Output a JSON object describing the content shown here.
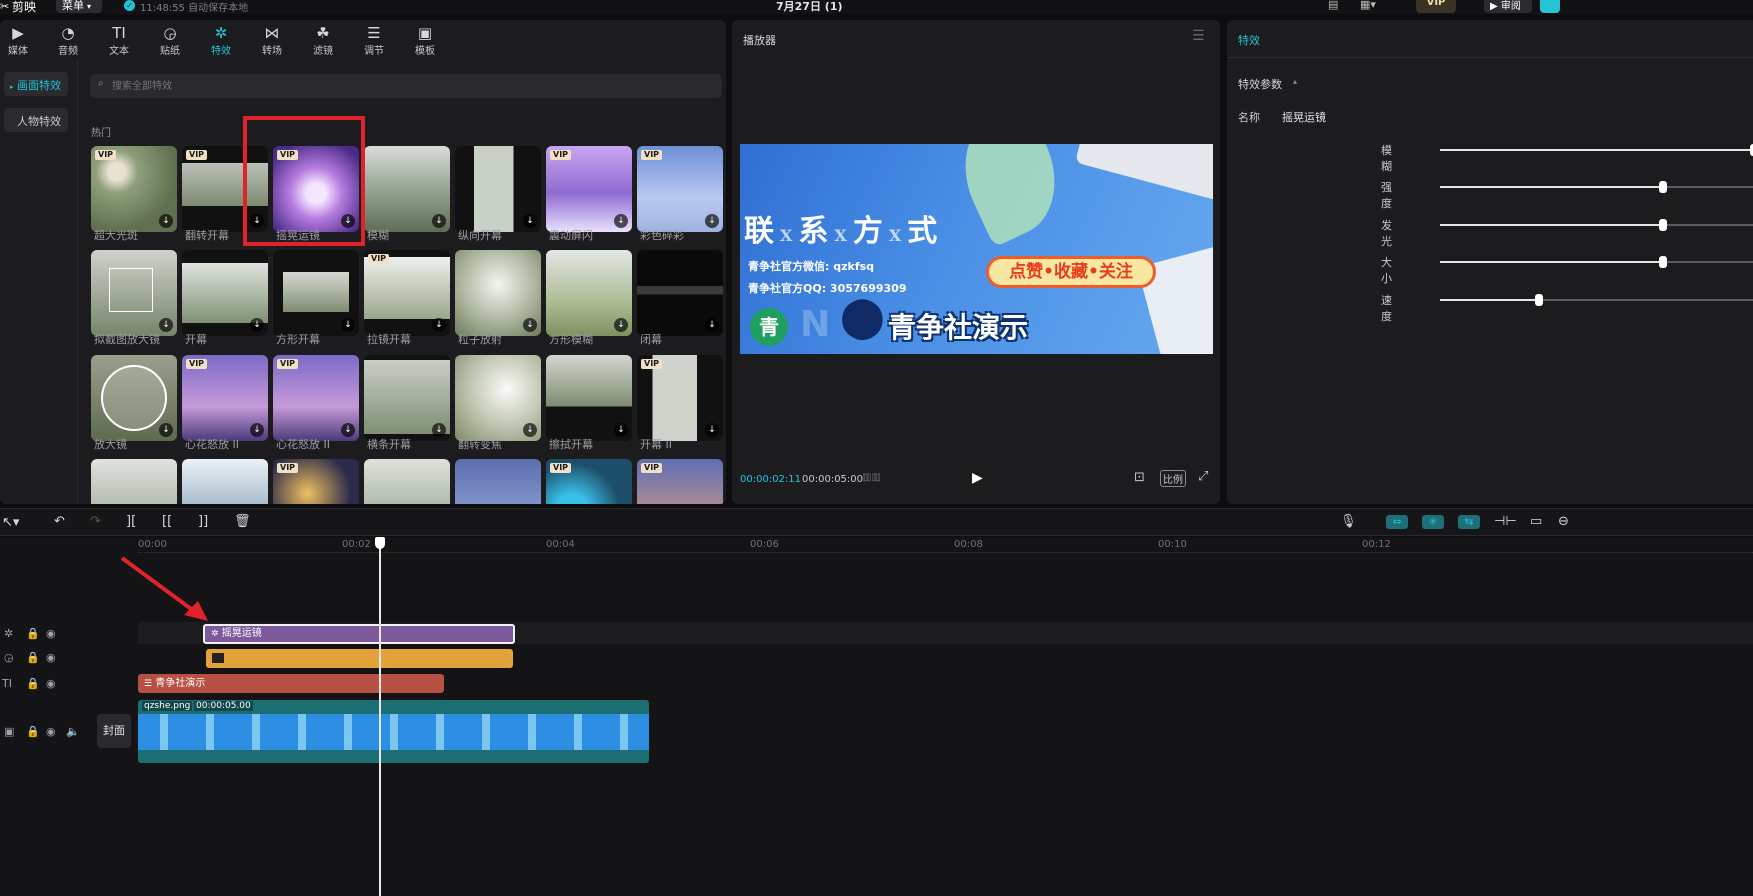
{
  "app": {
    "name": "剪映",
    "menu_label": "菜单",
    "autosave_text": "11:48:55 自动保存本地",
    "project_title": "7月27日 (1)",
    "vip_label": "VIP",
    "review_label": "审阅"
  },
  "toolbar": {
    "tabs": [
      {
        "label": "媒体",
        "icon": "media-icon"
      },
      {
        "label": "音频",
        "icon": "audio-icon"
      },
      {
        "label": "文本",
        "icon": "text-icon"
      },
      {
        "label": "贴纸",
        "icon": "sticker-icon"
      },
      {
        "label": "特效",
        "icon": "effects-icon"
      },
      {
        "label": "转场",
        "icon": "transition-icon"
      },
      {
        "label": "滤镜",
        "icon": "filter-icon"
      },
      {
        "label": "调节",
        "icon": "adjust-icon"
      },
      {
        "label": "模板",
        "icon": "template-icon"
      }
    ],
    "active_tab": "特效"
  },
  "effects_sidebar": {
    "items": [
      "画面特效",
      "人物特效"
    ],
    "active": "画面特效"
  },
  "effects_panel": {
    "search_placeholder": "搜索全部特效",
    "section_title": "热门",
    "vip_badge": "VIP",
    "download_glyph": "↓",
    "cards": [
      {
        "label": "超大光斑",
        "vip": true
      },
      {
        "label": "翻转开幕",
        "vip": true
      },
      {
        "label": "摇晃运镜",
        "vip": true,
        "highlighted": true
      },
      {
        "label": "模糊",
        "vip": false
      },
      {
        "label": "纵向开幕",
        "vip": false
      },
      {
        "label": "震动屏闪",
        "vip": true
      },
      {
        "label": "彩色碎彩",
        "vip": true
      },
      {
        "label": "拟截图放大镜",
        "vip": false
      },
      {
        "label": "开幕",
        "vip": false
      },
      {
        "label": "方形开幕",
        "vip": false
      },
      {
        "label": "拉镜开幕",
        "vip": true
      },
      {
        "label": "粒子放射",
        "vip": false
      },
      {
        "label": "方形模糊",
        "vip": false
      },
      {
        "label": "闭幕",
        "vip": false
      },
      {
        "label": "放大镜",
        "vip": false
      },
      {
        "label": "心花怒放 II",
        "vip": true
      },
      {
        "label": "心花怒放 II",
        "vip": true
      },
      {
        "label": "横条开幕",
        "vip": false
      },
      {
        "label": "翻转变焦",
        "vip": false
      },
      {
        "label": "擦拭开幕",
        "vip": false
      },
      {
        "label": "开幕 II",
        "vip": true
      },
      {
        "label": "",
        "vip": false
      },
      {
        "label": "",
        "vip": false
      },
      {
        "label": "",
        "vip": true
      },
      {
        "label": "",
        "vip": false
      },
      {
        "label": "",
        "vip": false
      },
      {
        "label": "",
        "vip": true
      },
      {
        "label": "",
        "vip": true
      }
    ]
  },
  "player": {
    "title": "播放器",
    "current_time": "00:00:02:11",
    "total_time": "00:00:05:00",
    "ratio_label": "比例",
    "preview": {
      "headline": [
        "联",
        "系",
        "方",
        "式"
      ],
      "separator": "X",
      "wechat_line": "青争社官方微信: qzkfsq",
      "qq_line": "青争社官方QQ: 3057699309",
      "action_banner": "点赞•收藏•关注",
      "brand_name": "青争社演示",
      "logo_char": "青",
      "watermark": "N"
    }
  },
  "inspector": {
    "tab_title": "特效",
    "section_title": "特效参数",
    "name_label": "名称",
    "name_value": "摇晃运镜",
    "params": [
      {
        "label": "模糊",
        "value": 1.0
      },
      {
        "label": "强度",
        "value": 0.7
      },
      {
        "label": "发光",
        "value": 0.7
      },
      {
        "label": "大小",
        "value": 0.7
      },
      {
        "label": "速度",
        "value": 0.31
      }
    ]
  },
  "timeline": {
    "ruler_ticks": [
      "00:00",
      "00:02",
      "00:04",
      "00:06",
      "00:08",
      "00:10",
      "00:12"
    ],
    "cover_label": "封面",
    "effect_clip_label": "摇晃运镜",
    "text_clip_label": "青争社演示",
    "video_clip_name": "qzshe.png",
    "video_clip_duration": "00:00:05.00"
  },
  "colors": {
    "accent": "#22c4d6",
    "highlight_box": "#e0232a",
    "effect_clip": "#7d5a9c",
    "sticker_clip": "#e3a33a",
    "text_clip": "#b65144",
    "video_clip_bg": "#1b6f73"
  }
}
